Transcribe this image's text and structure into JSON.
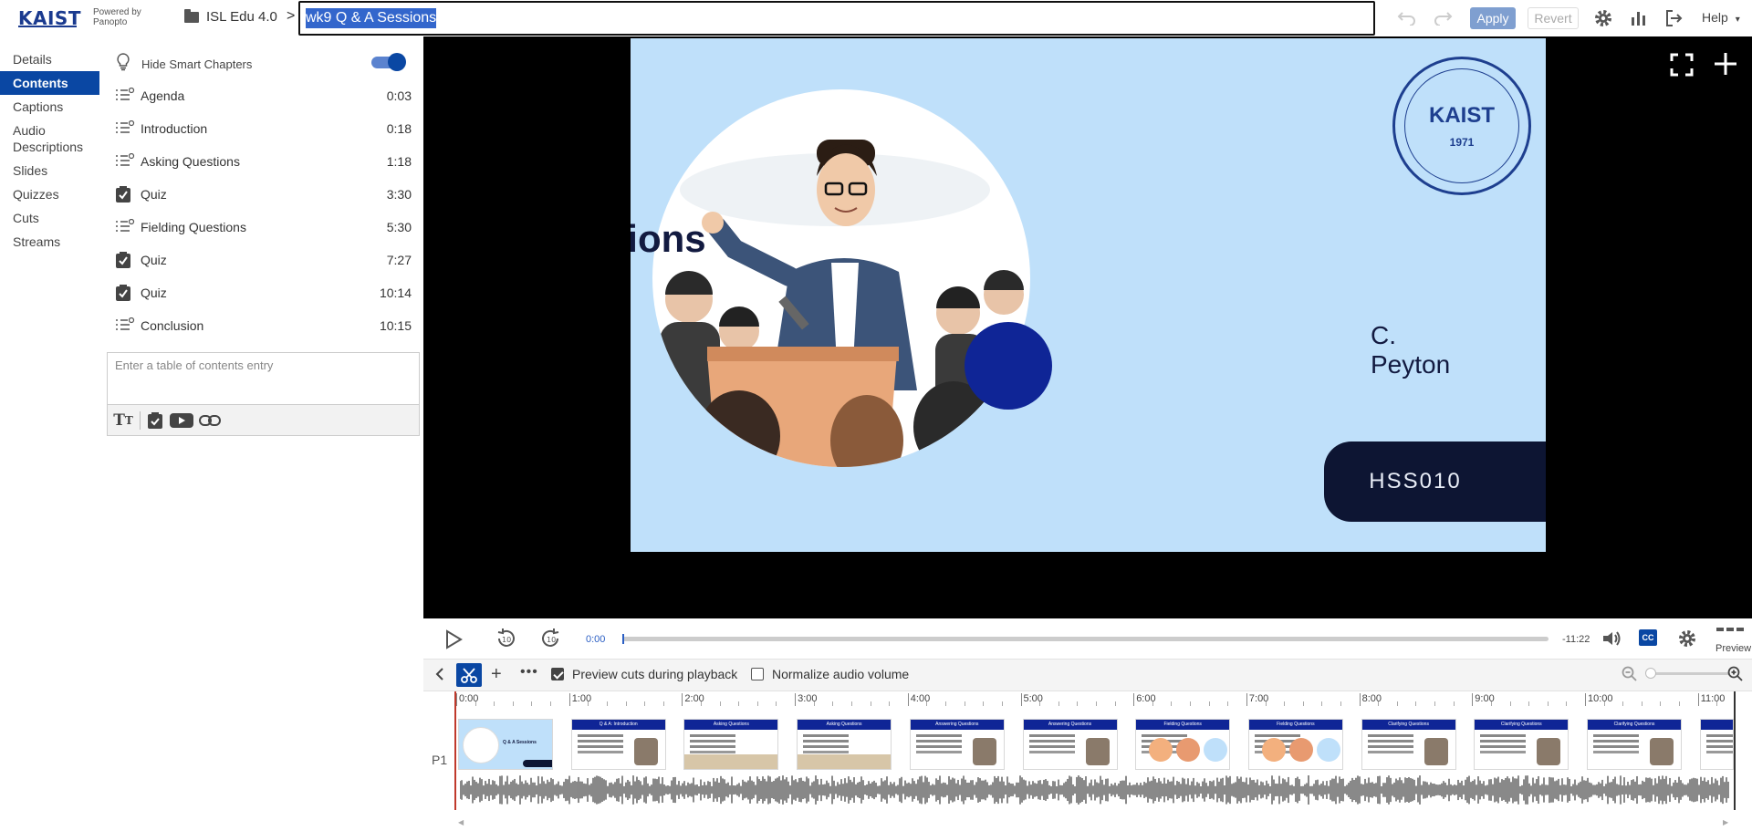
{
  "header": {
    "logo_text": "KAIST",
    "powered_line1": "Powered by",
    "powered_line2": "Panopto",
    "folder_name": "ISL Edu 4.0",
    "crumb_separator": ">",
    "session_title": "wk9 Q & A Sessions",
    "apply_label": "Apply",
    "revert_label": "Revert",
    "help_label": "Help",
    "icons": [
      "undo-icon",
      "redo-icon",
      "gear-icon",
      "stats-icon",
      "exit-icon",
      "chevron-down-icon"
    ]
  },
  "nav": {
    "items": [
      {
        "label": "Details",
        "active": false
      },
      {
        "label": "Contents",
        "active": true
      },
      {
        "label": "Captions",
        "active": false
      },
      {
        "label": "Audio Descriptions",
        "active": false
      },
      {
        "label": "Slides",
        "active": false
      },
      {
        "label": "Quizzes",
        "active": false
      },
      {
        "label": "Cuts",
        "active": false
      },
      {
        "label": "Streams",
        "active": false
      }
    ]
  },
  "contents": {
    "hide_smart_chapters_label": "Hide Smart Chapters",
    "hide_smart_chapters_on": true,
    "entries": [
      {
        "icon": "chapter-icon",
        "label": "Agenda",
        "time": "0:03"
      },
      {
        "icon": "chapter-icon",
        "label": "Introduction",
        "time": "0:18"
      },
      {
        "icon": "chapter-icon",
        "label": "Asking Questions",
        "time": "1:18"
      },
      {
        "icon": "quiz-icon",
        "label": "Quiz",
        "time": "3:30"
      },
      {
        "icon": "chapter-icon",
        "label": "Fielding Questions",
        "time": "5:30"
      },
      {
        "icon": "quiz-icon",
        "label": "Quiz",
        "time": "7:27"
      },
      {
        "icon": "quiz-icon",
        "label": "Quiz",
        "time": "10:14"
      },
      {
        "icon": "chapter-icon",
        "label": "Conclusion",
        "time": "10:15"
      }
    ],
    "entry_placeholder": "Enter a table of contents entry",
    "entry_tools": [
      "text-format-icon",
      "quiz-icon",
      "youtube-icon",
      "link-icon"
    ]
  },
  "slide": {
    "title": "Q & A Sessions",
    "author": "C. Peyton",
    "course_code": "HSS010",
    "seal_name": "KAIST",
    "seal_year": "1971",
    "colors": {
      "background": "#bfe0fa",
      "navy": "#0d1533",
      "dot": "#0f2596"
    }
  },
  "player": {
    "current_time": "0:00",
    "remaining_time": "-11:22",
    "cc_label": "CC",
    "preview_label": "Preview",
    "progress": 0.0
  },
  "editor": {
    "preview_cuts_label": "Preview cuts during playback",
    "preview_cuts_checked": true,
    "normalize_audio_label": "Normalize audio volume",
    "normalize_audio_checked": false
  },
  "timeline": {
    "track_label": "P1",
    "ticks": [
      "0:00",
      "1:00",
      "2:00",
      "3:00",
      "4:00",
      "5:00",
      "6:00",
      "7:00",
      "8:00",
      "9:00",
      "10:00",
      "11:00"
    ],
    "thumbnails": [
      {
        "title": "Q & A Sessions",
        "kind": "title"
      },
      {
        "title": "Q & A: Introduction",
        "kind": "face"
      },
      {
        "title": "Asking Questions",
        "kind": "list"
      },
      {
        "title": "Asking Questions",
        "kind": "list"
      },
      {
        "title": "Answering Questions",
        "kind": "face"
      },
      {
        "title": "Answering Questions",
        "kind": "face"
      },
      {
        "title": "Fielding Questions",
        "kind": "circles"
      },
      {
        "title": "Fielding Questions",
        "kind": "circles"
      },
      {
        "title": "Clarifying Questions",
        "kind": "face"
      },
      {
        "title": "Clarifying Questions",
        "kind": "face"
      },
      {
        "title": "Clarifying Questions",
        "kind": "face"
      },
      {
        "title": "",
        "kind": "face"
      }
    ]
  }
}
